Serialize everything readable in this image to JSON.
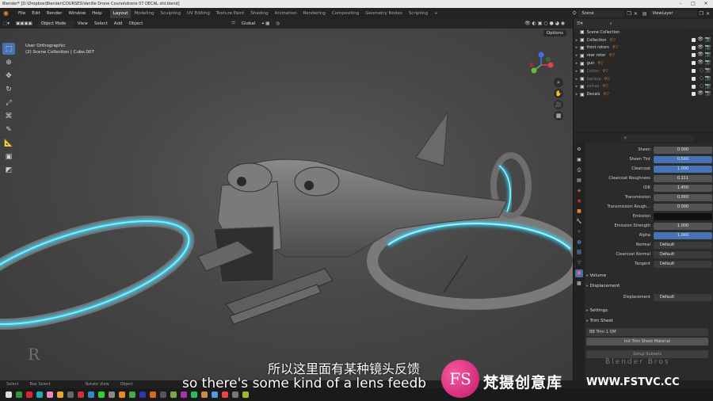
{
  "window": {
    "title": "Blender* [D:\\Dropbox\\Blender\\COURSES\\Vanille Drone Course\\drone 07 DECAL std.blend]"
  },
  "menu": [
    "File",
    "Edit",
    "Render",
    "Window",
    "Help"
  ],
  "workspaces": [
    "Layout",
    "Modeling",
    "Sculpting",
    "UV Editing",
    "Texture Paint",
    "Shading",
    "Animation",
    "Rendering",
    "Compositing",
    "Geometry Nodes",
    "Scripting"
  ],
  "active_workspace": "Layout",
  "scene": "Scene",
  "view_layer": "ViewLayer",
  "viewport_header": {
    "mode": "Object Mode",
    "items": [
      "View",
      "Select",
      "Add",
      "Object"
    ],
    "orientation": "Global",
    "options": "Options"
  },
  "viewport_info": {
    "view": "User Orthographic",
    "collection": "(2) Scene Collection | Cube.007"
  },
  "outliner": {
    "root": "Scene Collection",
    "items": [
      {
        "name": "Collection",
        "dim": false
      },
      {
        "name": "front rotors",
        "dim": false
      },
      {
        "name": "rear rotor",
        "dim": false
      },
      {
        "name": "gun",
        "dim": false
      },
      {
        "name": "Cutter",
        "dim": true
      },
      {
        "name": "backup",
        "dim": true
      },
      {
        "name": "extras",
        "dim": true
      },
      {
        "name": "Decals",
        "dim": false
      }
    ]
  },
  "properties": {
    "rows": [
      {
        "label": "Sheen",
        "value": "0.000",
        "style": ""
      },
      {
        "label": "Sheen Tint",
        "value": "0.500",
        "style": "blue"
      },
      {
        "label": "Clearcoat",
        "value": "1.000",
        "style": "blue"
      },
      {
        "label": "Clearcoat Roughness",
        "value": "0.111",
        "style": ""
      },
      {
        "label": "IOR",
        "value": "1.450",
        "style": ""
      },
      {
        "label": "Transmission",
        "value": "0.000",
        "style": ""
      },
      {
        "label": "Transmission Rough...",
        "value": "0.000",
        "style": ""
      },
      {
        "label": "Emission",
        "value": "",
        "style": "dark"
      },
      {
        "label": "Emission Strength",
        "value": "1.000",
        "style": ""
      },
      {
        "label": "Alpha",
        "value": "1.000",
        "style": "blue"
      },
      {
        "label": "Normal",
        "value": "Default",
        "style": "sock"
      },
      {
        "label": "Clearcoat Normal",
        "value": "Default",
        "style": "sock"
      },
      {
        "label": "Tangent",
        "value": "Default",
        "style": "sock"
      }
    ],
    "volume": "Volume",
    "displacement_header": "Displacement",
    "displacement_label": "Displacement",
    "displacement_value": "Default",
    "settings": "Settings",
    "trim_sheet": "Trim Sheet",
    "trim_value": "BB Trim 1 QM",
    "trim_button": "Init Trim Sheet Material",
    "subsets_button": "Setup Subsets",
    "brand": "Blender Bros"
  },
  "statusbar": [
    "Select",
    "Box Select",
    "Rotate View",
    "Object"
  ],
  "subtitles": {
    "cn": "所以这里面有某种镜头反馈",
    "en": "so there's some kind of a lens feedb"
  },
  "watermark": {
    "logo": "FS",
    "cn": "梵摄创意库",
    "url": "WWW.FSTVC.CC"
  },
  "colors": {
    "accent": "#4772b3",
    "glow": "#2fd7ff",
    "outliner_icon": "#e8882c"
  }
}
